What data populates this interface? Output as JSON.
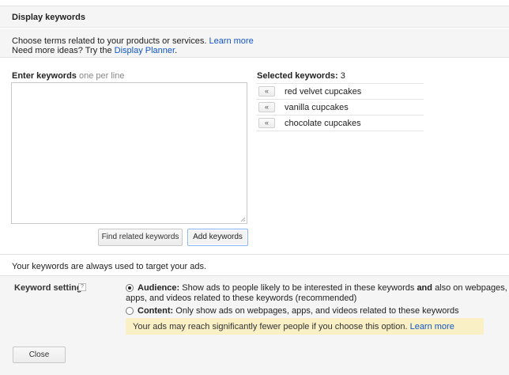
{
  "header": {
    "title": "Display keywords"
  },
  "intro": {
    "line1_text": "Choose terms related to your products or services.",
    "line1_link": "Learn more",
    "line2_text": "Need more ideas? Try the",
    "line2_link": "Display Planner",
    "line2_end": "."
  },
  "enter": {
    "label": "Enter keywords",
    "hint": "one per line",
    "value": ""
  },
  "buttons": {
    "find_related": "Find related keywords",
    "add_keywords": "Add keywords",
    "close": "Close"
  },
  "selected": {
    "label": "Selected keywords:",
    "count": "3",
    "remove_glyph": "«",
    "keywords": [
      "red velvet cupcakes",
      "vanilla cupcakes",
      "chocolate cupcakes"
    ]
  },
  "notice": "Your keywords are always used to target your ads.",
  "setting": {
    "label": "Keyword setting",
    "help_glyph": "?",
    "audience": {
      "title": "Audience:",
      "text_a": "Show ads to people likely to be interested in these keywords",
      "text_and": "and",
      "text_b": "also on webpages,",
      "text_line2": "apps, and videos related to these keywords (recommended)",
      "selected": true
    },
    "content": {
      "title": "Content:",
      "text": "Only show ads on webpages, apps, and videos related to these keywords",
      "selected": false
    },
    "warning": {
      "text": "Your ads may reach significantly fewer people if you choose this option.",
      "link": "Learn more"
    }
  }
}
